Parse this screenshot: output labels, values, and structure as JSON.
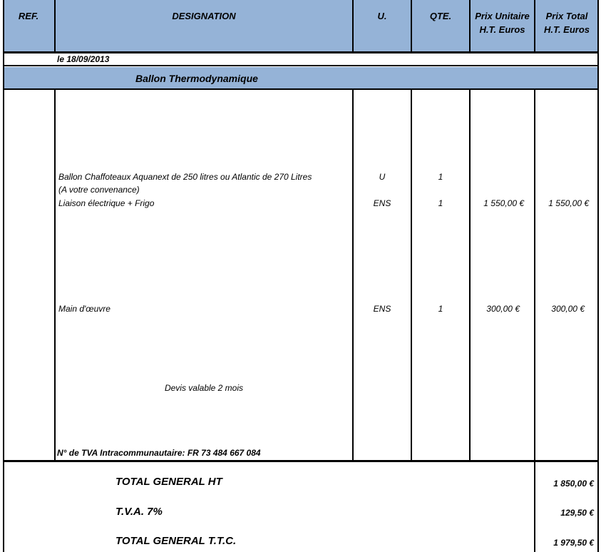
{
  "header": {
    "ref": "REF.",
    "designation": "DESIGNATION",
    "unit": "U.",
    "qty": "QTE.",
    "unit_price_l1": "Prix Unitaire",
    "unit_price_l2": "H.T. Euros",
    "total_price_l1": "Prix Total",
    "total_price_l2": "H.T. Euros"
  },
  "date": "le 18/09/2013",
  "section_title": "Ballon Thermodynamique",
  "lines": [
    {
      "designation": "Ballon Chaffoteaux Aquanext de 250 litres ou Atlantic de 270 Litres",
      "unit": "U",
      "qty": "1",
      "unit_price": "",
      "total": ""
    },
    {
      "designation": "(A votre convenance)",
      "unit": "",
      "qty": "",
      "unit_price": "",
      "total": ""
    },
    {
      "designation": "Liaison électrique + Frigo",
      "unit": "ENS",
      "qty": "1",
      "unit_price": "1 550,00 €",
      "total": "1 550,00 €"
    },
    {
      "designation": "Main d'œuvre",
      "unit": "ENS",
      "qty": "1",
      "unit_price": "300,00 €",
      "total": "300,00 €"
    }
  ],
  "validity_note": "Devis valable 2 mois",
  "vat_number": "N° de TVA Intracommunautaire:  FR 73 484 667 084",
  "totals": {
    "ht_label": "TOTAL GENERAL HT",
    "ht_value": "1 850,00 €",
    "tva_label": "T.V.A. 7%",
    "tva_value": "129,50 €",
    "ttc_label": "TOTAL GENERAL T.T.C.",
    "ttc_value": "1 979,50 €"
  }
}
